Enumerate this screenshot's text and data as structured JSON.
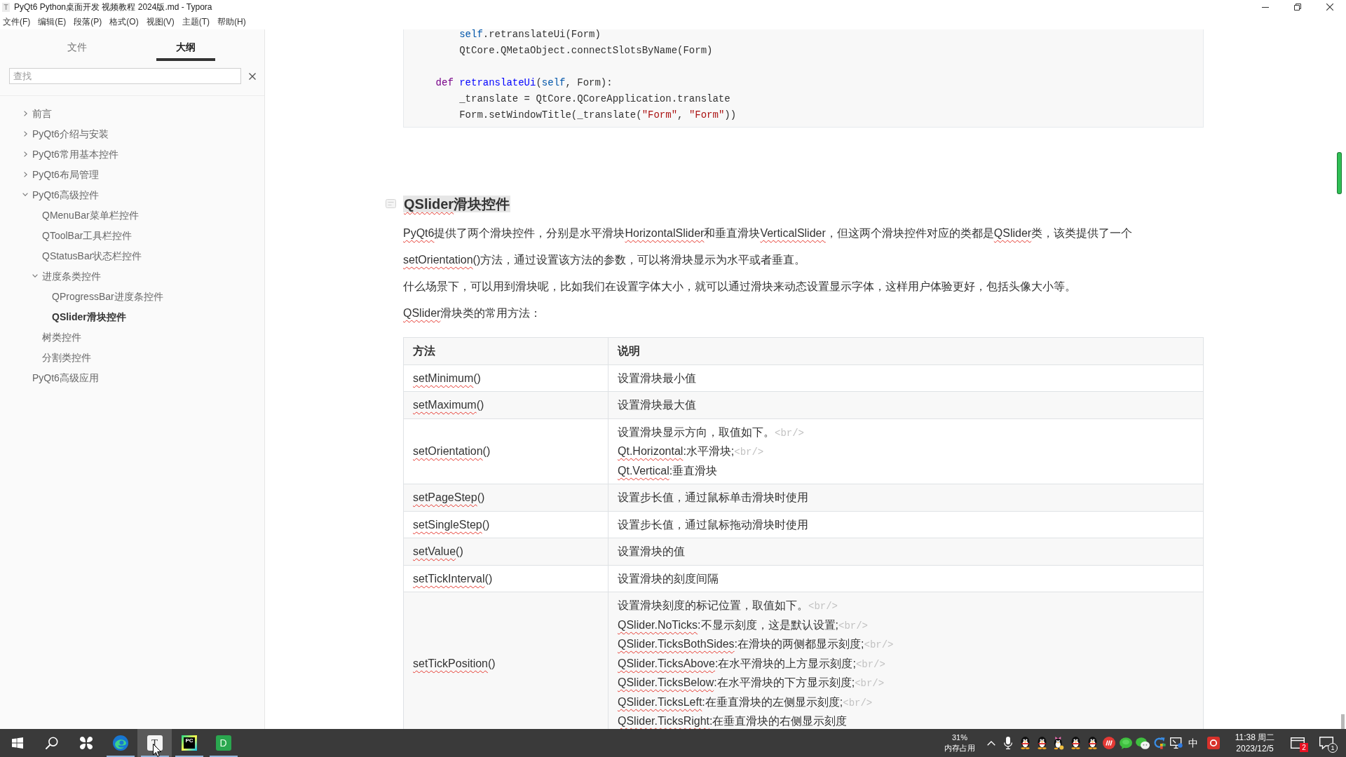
{
  "window": {
    "icon_letter": "T",
    "title": "PyQt6 Python桌面开发 视频教程 2024版.md - Typora"
  },
  "menu": [
    "文件(F)",
    "编辑(E)",
    "段落(P)",
    "格式(O)",
    "视图(V)",
    "主题(T)",
    "帮助(H)"
  ],
  "sidebar": {
    "tabs": [
      {
        "label": "文件",
        "selected": false
      },
      {
        "label": "大纲",
        "selected": true
      }
    ],
    "search": {
      "placeholder": "查找"
    },
    "outline": [
      {
        "label": "前言",
        "expanded": false,
        "selected": false
      },
      {
        "label": "PyQt6介绍与安装",
        "expanded": false,
        "selected": false
      },
      {
        "label": "PyQt6常用基本控件",
        "expanded": false,
        "selected": false
      },
      {
        "label": "PyQt6布局管理",
        "expanded": false,
        "selected": false
      },
      {
        "label": "PyQt6高级控件",
        "expanded": true,
        "selected": false,
        "children": [
          {
            "label": "QMenuBar菜单栏控件",
            "selected": false
          },
          {
            "label": "QToolBar工具栏控件",
            "selected": false
          },
          {
            "label": "QStatusBar状态栏控件",
            "selected": false
          },
          {
            "label": "进度条类控件",
            "expanded": true,
            "selected": false,
            "children": [
              {
                "label": "QProgressBar进度条控件",
                "selected": false
              },
              {
                "label": "QSlider滑块控件",
                "selected": true
              }
            ]
          },
          {
            "label": "树类控件",
            "selected": false
          },
          {
            "label": "分割类控件",
            "selected": false
          }
        ]
      },
      {
        "label": "PyQt6高级应用",
        "selected": false
      }
    ]
  },
  "document": {
    "code_block": {
      "lines": [
        {
          "kind": "code",
          "parts": [
            {
              "text": "        self",
              "kind": "variable"
            },
            {
              "text": ".retranslateUi(Form)",
              "kind": "plain"
            }
          ]
        },
        {
          "kind": "code",
          "parts": [
            {
              "text": "        QtCore.QMetaObject.connectSlotsByName(Form)",
              "kind": "plain"
            }
          ]
        },
        {
          "kind": "blank"
        },
        {
          "kind": "code",
          "parts": [
            {
              "text": "    def ",
              "kind": "keyword"
            },
            {
              "text": "retranslateUi",
              "kind": "def"
            },
            {
              "text": "(",
              "kind": "plain"
            },
            {
              "text": "self",
              "kind": "variable"
            },
            {
              "text": ", Form):",
              "kind": "plain"
            }
          ]
        },
        {
          "kind": "code",
          "parts": [
            {
              "text": "        _translate = QtCore.QCoreApplication.translate",
              "kind": "plain"
            }
          ]
        },
        {
          "kind": "code",
          "parts": [
            {
              "text": "        Form.setWindowTitle(_translate(",
              "kind": "plain"
            },
            {
              "text": "\"Form\"",
              "kind": "string"
            },
            {
              "text": ", ",
              "kind": "plain"
            },
            {
              "text": "\"Form\"",
              "kind": "string"
            },
            {
              "text": "))",
              "kind": "plain"
            }
          ]
        }
      ]
    },
    "heading": {
      "highlighted": true,
      "parts": [
        {
          "text": "QSlider",
          "kind": "flagged"
        },
        {
          "text": "滑块控件",
          "kind": "text"
        }
      ]
    },
    "paragraphs": [
      {
        "parts": [
          {
            "text": "PyQt6",
            "kind": "flagged"
          },
          {
            "text": "提供了两个滑块控件，分别是水平滑块",
            "kind": "text"
          },
          {
            "text": "HorizontalSlider",
            "kind": "flagged"
          },
          {
            "text": "和垂直滑块",
            "kind": "text"
          },
          {
            "text": "VerticalSlider",
            "kind": "flagged"
          },
          {
            "text": "，但这两个滑块控件对应的类都是",
            "kind": "text"
          },
          {
            "text": "QSlider",
            "kind": "flagged"
          },
          {
            "text": "类，该类提供了一个",
            "kind": "text"
          },
          {
            "text": "setOrientation",
            "kind": "flagged"
          },
          {
            "text": "()方法，通过设置该方法的参数，可以将滑块显示为水平或者垂直。",
            "kind": "text"
          }
        ]
      },
      {
        "parts": [
          {
            "text": "什么场景下，可以用到滑块呢，比如我们在设置字体大小，就可以通过滑块来动态设置显示字体，这样用户体验更好，包括头像大小等。",
            "kind": "text"
          }
        ]
      },
      {
        "parts": [
          {
            "text": "QSlider",
            "kind": "flagged"
          },
          {
            "text": "滑块类的常用方法：",
            "kind": "text"
          }
        ]
      }
    ],
    "table": {
      "columns": [
        "方法",
        "说明"
      ],
      "rows": [
        {
          "method": [
            {
              "text": "setMinimum",
              "kind": "flagged"
            },
            {
              "text": "()",
              "kind": "text"
            }
          ],
          "description": [
            [
              {
                "text": "设置滑块最小值",
                "kind": "text"
              }
            ]
          ]
        },
        {
          "method": [
            {
              "text": "setMaximum",
              "kind": "flagged"
            },
            {
              "text": "()",
              "kind": "text"
            }
          ],
          "description": [
            [
              {
                "text": "设置滑块最大值",
                "kind": "text"
              }
            ]
          ]
        },
        {
          "method": [
            {
              "text": "setOrientation",
              "kind": "flagged"
            },
            {
              "text": "()",
              "kind": "text"
            }
          ],
          "description": [
            [
              {
                "text": "设置滑块显示方向，取值如下。",
                "kind": "text"
              },
              {
                "text": "<br/>",
                "kind": "tag"
              }
            ],
            [
              {
                "text": "Qt.Horizontal",
                "kind": "flagged"
              },
              {
                "text": ":水平滑块;",
                "kind": "text"
              },
              {
                "text": "<br/>",
                "kind": "tag"
              }
            ],
            [
              {
                "text": "Qt.Vertical",
                "kind": "flagged"
              },
              {
                "text": ":垂直滑块",
                "kind": "text"
              }
            ]
          ]
        },
        {
          "method": [
            {
              "text": "setPageStep",
              "kind": "flagged"
            },
            {
              "text": "()",
              "kind": "text"
            }
          ],
          "description": [
            [
              {
                "text": "设置步长值，通过鼠标单击滑块时使用",
                "kind": "text"
              }
            ]
          ]
        },
        {
          "method": [
            {
              "text": "setSingleStep",
              "kind": "flagged"
            },
            {
              "text": "()",
              "kind": "text"
            }
          ],
          "description": [
            [
              {
                "text": "设置步长值，通过鼠标拖动滑块时使用",
                "kind": "text"
              }
            ]
          ]
        },
        {
          "method": [
            {
              "text": "setValue",
              "kind": "flagged"
            },
            {
              "text": "()",
              "kind": "text"
            }
          ],
          "description": [
            [
              {
                "text": "设置滑块的值",
                "kind": "text"
              }
            ]
          ]
        },
        {
          "method": [
            {
              "text": "setTickInterval",
              "kind": "flagged"
            },
            {
              "text": "()",
              "kind": "text"
            }
          ],
          "description": [
            [
              {
                "text": "设置滑块的刻度间隔",
                "kind": "text"
              }
            ]
          ]
        },
        {
          "method": [
            {
              "text": "setTickPosition",
              "kind": "flagged"
            },
            {
              "text": "()",
              "kind": "text"
            }
          ],
          "description": [
            [
              {
                "text": "设置滑块刻度的标记位置，取值如下。",
                "kind": "text"
              },
              {
                "text": "<br/>",
                "kind": "tag"
              }
            ],
            [
              {
                "text": "QSlider.NoTicks",
                "kind": "flagged"
              },
              {
                "text": ":不显示刻度，这是默认设置;",
                "kind": "text"
              },
              {
                "text": "<br/>",
                "kind": "tag"
              }
            ],
            [
              {
                "text": "QSlider.TicksBothSides",
                "kind": "flagged"
              },
              {
                "text": ":在滑块的两侧都显示刻度;",
                "kind": "text"
              },
              {
                "text": "<br/>",
                "kind": "tag"
              }
            ],
            [
              {
                "text": "QSlider.TicksAbove",
                "kind": "flagged"
              },
              {
                "text": ":在水平滑块的上方显示刻度;",
                "kind": "text"
              },
              {
                "text": "<br/>",
                "kind": "tag"
              }
            ],
            [
              {
                "text": "QSlider.TicksBelow",
                "kind": "flagged"
              },
              {
                "text": ":在水平滑块的下方显示刻度;",
                "kind": "text"
              },
              {
                "text": "<br/>",
                "kind": "tag"
              }
            ],
            [
              {
                "text": "QSlider.TicksLeft",
                "kind": "flagged"
              },
              {
                "text": ":在垂直滑块的左侧显示刻度;",
                "kind": "text"
              },
              {
                "text": "<br/>",
                "kind": "tag"
              }
            ],
            [
              {
                "text": "QSlider.TicksRight",
                "kind": "flagged"
              },
              {
                "text": ":在垂直滑块的右侧显示刻度",
                "kind": "text"
              }
            ]
          ]
        }
      ]
    }
  },
  "taskbar": {
    "apps": [
      {
        "kind": "start"
      },
      {
        "kind": "search"
      },
      {
        "kind": "widgets"
      },
      {
        "kind": "browser",
        "running": true,
        "active": false
      },
      {
        "kind": "letter_tile",
        "glyph": "T",
        "running": true,
        "active": true
      },
      {
        "kind": "gradient_tile",
        "glyph": "PC",
        "running": true,
        "active": false
      },
      {
        "kind": "green_tile",
        "glyph": "D",
        "running": true,
        "active": false
      }
    ],
    "memory": {
      "reading": "31%",
      "label": "内存占用"
    },
    "tray": [
      {
        "kind": "caret"
      },
      {
        "kind": "microphone"
      },
      {
        "kind": "penguin"
      },
      {
        "kind": "penguin"
      },
      {
        "kind": "penguin_bow"
      },
      {
        "kind": "penguin"
      },
      {
        "kind": "penguin"
      },
      {
        "kind": "striped_circle"
      },
      {
        "kind": "chat_bubble"
      },
      {
        "kind": "chat_bubbles"
      },
      {
        "kind": "ring_arrow"
      },
      {
        "kind": "monitor"
      },
      {
        "kind": "text",
        "text": "中"
      },
      {
        "kind": "tile"
      }
    ],
    "clock": {
      "time": "11:38 周二",
      "date": "2023/12/5"
    },
    "notifications": {
      "count": "2"
    },
    "action_center": {
      "count": "1"
    }
  }
}
